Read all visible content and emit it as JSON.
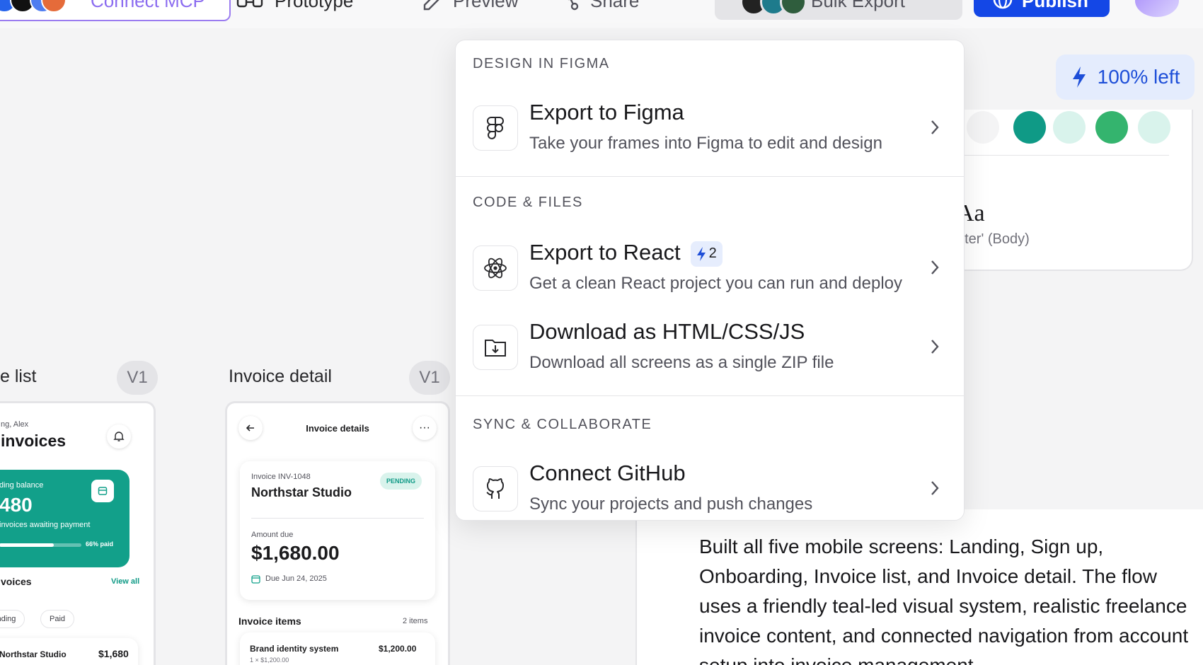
{
  "toolbar": {
    "connect_label": "Connect MCP",
    "prototype_label": "Prototype",
    "preview_label": "Preview",
    "share_label": "Share",
    "bulk_export_label": "Bulk Export",
    "publish_label": "Publish"
  },
  "credits": {
    "label": "100% left"
  },
  "style_panel": {
    "type_sample": "Aa",
    "type_name": "nter' (Body)",
    "swatches": [
      "#f4f4f5",
      "#0f9a86",
      "#d9f3ec",
      "#34b46e",
      "#d9f3ec"
    ]
  },
  "chat": {
    "message": "Built all five mobile screens: Landing, Sign up, Onboarding, Invoice list, and Invoice detail. The flow uses a friendly teal-led visual system, realistic freelance invoice content, and connected navigation from account setup into invoice management."
  },
  "frames": {
    "list": {
      "title": "e list",
      "version": "V1",
      "greeting": "ng, Alex",
      "heading": "invoices",
      "balance_label": "ding balance",
      "balance_value": "480",
      "balance_sub": "invoices awaiting payment",
      "progress_label": "66% paid",
      "progress": 0.66,
      "section_title": "voices",
      "view_all": "View all",
      "filters": [
        "Pending",
        "Paid"
      ],
      "row_client": "Northstar Studio",
      "row_amount": "$1,680"
    },
    "detail": {
      "title": "Invoice detail",
      "version": "V1",
      "header": "Invoice details",
      "invoice_number": "Invoice INV-1048",
      "client": "Northstar Studio",
      "status": "PENDING",
      "amount_label": "Amount due",
      "amount": "$1,680.00",
      "due": "Due Jun 24, 2025",
      "items_title": "Invoice items",
      "items_count": "2 items",
      "item_name": "Brand identity system",
      "item_price": "$1,200.00",
      "item_meta": "1 × $1,200.00"
    }
  },
  "menu": {
    "sections": [
      {
        "header": "DESIGN IN FIGMA",
        "items": [
          {
            "icon": "figma-icon",
            "title": "Export to Figma",
            "description": "Take your frames into Figma to edit and design"
          }
        ]
      },
      {
        "header": "CODE & FILES",
        "items": [
          {
            "icon": "react-icon",
            "title": "Export to React",
            "badge": "2",
            "description": "Get a clean React project you can run and deploy"
          },
          {
            "icon": "folder-download-icon",
            "title": "Download as HTML/CSS/JS",
            "description": "Download all screens as a single ZIP file"
          }
        ]
      },
      {
        "header": "SYNC & COLLABORATE",
        "items": [
          {
            "icon": "github-icon",
            "title": "Connect GitHub",
            "description": "Sync your projects and push changes"
          }
        ]
      }
    ]
  }
}
